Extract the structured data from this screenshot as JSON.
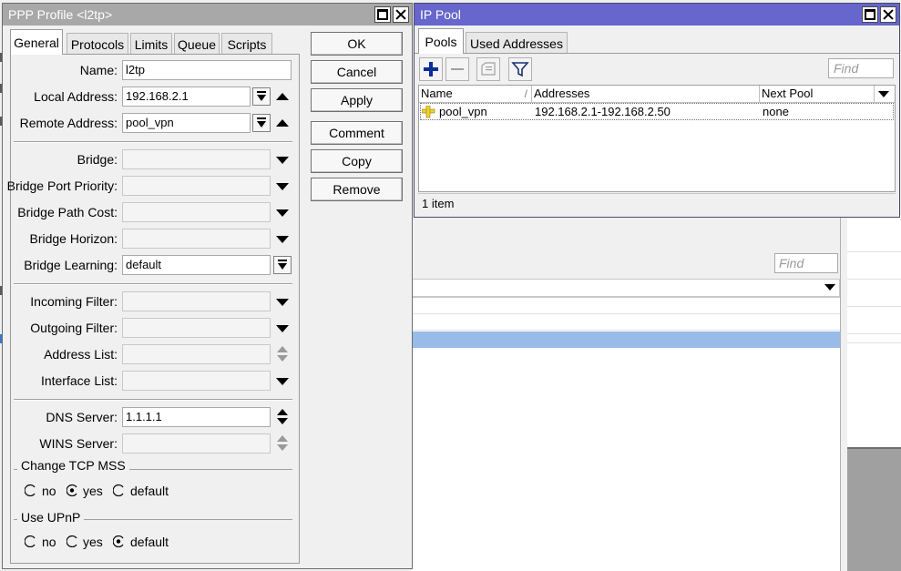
{
  "ppp_window": {
    "title": "PPP Profile <l2tp>",
    "tabs": [
      "General",
      "Protocols",
      "Limits",
      "Queue",
      "Scripts"
    ],
    "active_tab": "General",
    "fields": {
      "name": {
        "label": "Name:",
        "value": "l2tp"
      },
      "local_address": {
        "label": "Local Address:",
        "value": "192.168.2.1"
      },
      "remote_address": {
        "label": "Remote Address:",
        "value": "pool_vpn"
      },
      "bridge": {
        "label": "Bridge:",
        "value": ""
      },
      "bridge_port_priority": {
        "label": "Bridge Port Priority:",
        "value": ""
      },
      "bridge_path_cost": {
        "label": "Bridge Path Cost:",
        "value": ""
      },
      "bridge_horizon": {
        "label": "Bridge Horizon:",
        "value": ""
      },
      "bridge_learning": {
        "label": "Bridge Learning:",
        "value": "default"
      },
      "incoming_filter": {
        "label": "Incoming Filter:",
        "value": ""
      },
      "outgoing_filter": {
        "label": "Outgoing Filter:",
        "value": ""
      },
      "address_list": {
        "label": "Address List:",
        "value": ""
      },
      "interface_list": {
        "label": "Interface List:",
        "value": ""
      },
      "dns_server": {
        "label": "DNS Server:",
        "value": "1.1.1.1"
      },
      "wins_server": {
        "label": "WINS Server:",
        "value": ""
      }
    },
    "change_tcp_mss": {
      "title": "Change TCP MSS",
      "options": [
        "no",
        "yes",
        "default"
      ],
      "selected": "yes"
    },
    "use_upnp": {
      "title": "Use UPnP",
      "options": [
        "no",
        "yes",
        "default"
      ],
      "selected": "default"
    },
    "buttons": {
      "ok": "OK",
      "cancel": "Cancel",
      "apply": "Apply",
      "comment": "Comment",
      "copy": "Copy",
      "remove": "Remove"
    }
  },
  "pool_window": {
    "title": "IP Pool",
    "tabs": [
      "Pools",
      "Used Addresses"
    ],
    "active_tab": "Pools",
    "find_placeholder": "Find",
    "columns": [
      "Name",
      "Addresses",
      "Next Pool"
    ],
    "rows": [
      {
        "name": "pool_vpn",
        "addresses": "192.168.2.1-192.168.2.50",
        "next_pool": "none"
      }
    ],
    "status": "1 item"
  },
  "background_window": {
    "find_placeholder": "Find"
  },
  "colors": {
    "pool_titlebar": "#6666cc",
    "ppp_titlebar": "#a8a8a8",
    "selection_row": "#99bbe8",
    "add_icon": "#0b2c9c"
  }
}
